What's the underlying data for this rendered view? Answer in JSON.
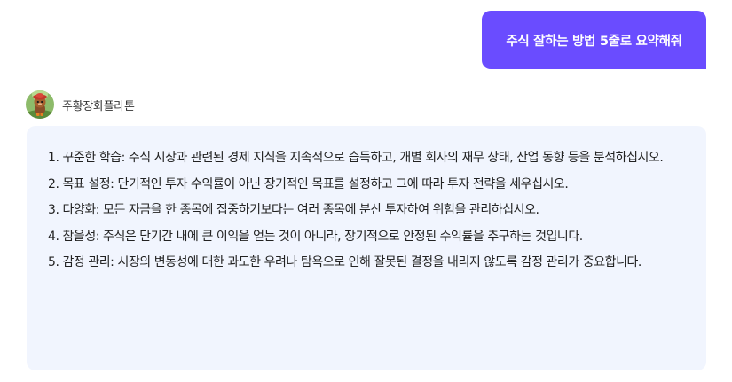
{
  "user_message": {
    "text": "주식 잘하는 방법 5줄로 요약해줘"
  },
  "bot": {
    "name": "주황장화플라톤",
    "avatar_icon": "cartoon-animal-avatar-icon"
  },
  "answer": {
    "lines": [
      "1. 꾸준한 학습: 주식 시장과 관련된 경제 지식을 지속적으로 습득하고, 개별 회사의 재무 상태, 산업 동향 등을 분석하십시오.",
      "2. 목표 설정: 단기적인 투자 수익률이 아닌 장기적인 목표를 설정하고 그에 따라 투자 전략을 세우십시오.",
      "3. 다양화: 모든 자금을 한 종목에 집중하기보다는 여러 종목에 분산 투자하여 위험을 관리하십시오.",
      "4. 참을성: 주식은 단기간 내에 큰 이익을 얻는 것이 아니라, 장기적으로 안정된 수익률을 추구하는 것입니다.",
      "5. 감정 관리: 시장의 변동성에 대한 과도한 우려나 탐욕으로 인해 잘못된 결정을 내리지 않도록 감정 관리가 중요합니다."
    ]
  },
  "colors": {
    "user_bubble": "#6a4cff",
    "bot_bubble": "#f1f5fe",
    "text": "#222222"
  }
}
